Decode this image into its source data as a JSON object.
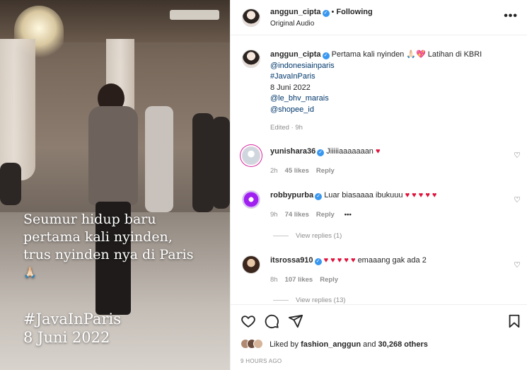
{
  "video": {
    "overlay_lines": [
      "Seumur hidup baru",
      "pertama kali nyinden,",
      "trus nyinden nya di Paris",
      "🙏🏻"
    ],
    "hashtag": "#JavaInParis",
    "date": "8 Juni 2022"
  },
  "header": {
    "username": "anggun_cipta",
    "verified": "✓",
    "separator": "•",
    "follow_status": "Following",
    "audio": "Original Audio",
    "more": "•••"
  },
  "caption": {
    "username": "anggun_cipta",
    "text": "Pertama kali nyinden 🙏🏻💖 Latihan di KBRI",
    "mention1": "@indonesiainparis",
    "hashtag": "#JavaInParis",
    "date": "8 Juni 2022",
    "mention2": "@le_bhv_marais",
    "mention3": "@shopee_id",
    "edited": "Edited · 9h"
  },
  "comments": [
    {
      "username": "yunishara36",
      "text": "Jiiiiiaaaaaaan",
      "emoji": "♥",
      "time": "2h",
      "likes": "45 likes",
      "reply": "Reply"
    },
    {
      "username": "robbypurba",
      "text": "Luar biasaaaa ibukuuu",
      "emoji": "♥ ♥ ♥ ♥ ♥",
      "time": "9h",
      "likes": "74 likes",
      "reply": "Reply",
      "more": "•••",
      "view_replies": "View replies (1)"
    },
    {
      "username": "itsrossa910",
      "emoji": "♥ ♥ ♥ ♥ ♥",
      "text": "emaaang gak ada 2",
      "time": "8h",
      "likes": "107 likes",
      "reply": "Reply",
      "view_replies": "View replies (13)"
    }
  ],
  "footer": {
    "liked_prefix": "Liked by",
    "liked_user": "fashion_anggun",
    "liked_and": "and",
    "liked_count": "30,268 others",
    "time_ago": "9 HOURS AGO"
  },
  "colors": {
    "verified_blue": "#3897f0",
    "heart_red": "#e0123c",
    "link_blue": "#00376b",
    "muted_gray": "#8e8e8e"
  },
  "icons": [
    "heart-icon",
    "comment-icon",
    "share-icon",
    "bookmark-icon",
    "more-icon",
    "verified-icon"
  ]
}
